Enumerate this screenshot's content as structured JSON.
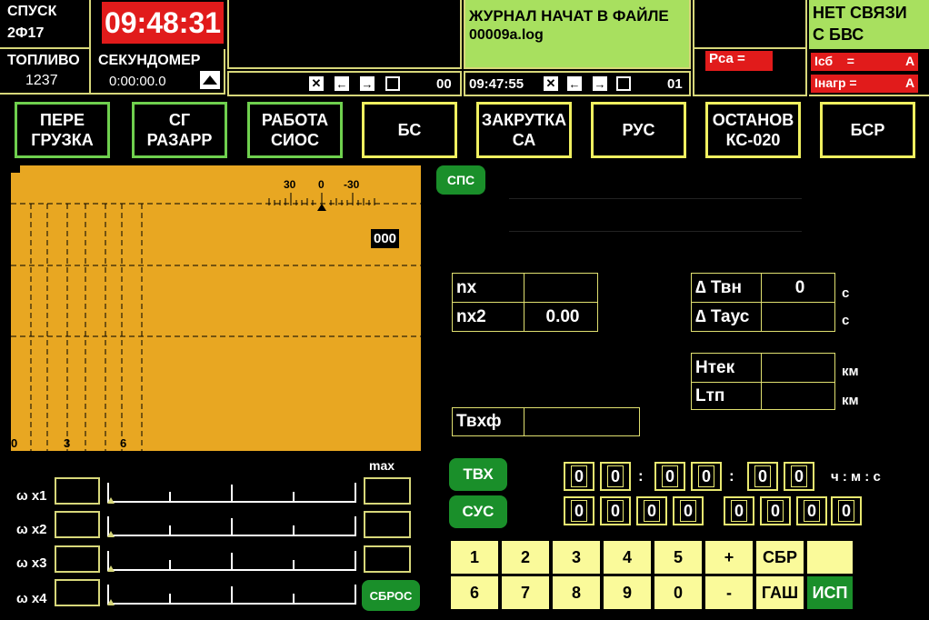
{
  "status": {
    "descent_label": "СПУСК",
    "descent_code": "2Ф17",
    "clock": "09:48:31",
    "fuel_label": "ТОПЛИВО",
    "fuel_value": "1237",
    "stopwatch_label": "СЕКУНДОМЕР",
    "stopwatch_value": "0:00:00.0"
  },
  "log": {
    "message_line1": "ЖУРНАЛ НАЧАТ В ФАЙЛЕ",
    "message_line2": "00009a.log",
    "left_counter": "00",
    "right_time": "09:47:55",
    "right_counter": "01"
  },
  "comm": {
    "rsa_label": "Рса  =",
    "status_line1": "НЕТ СВЯЗИ",
    "status_line2": "С БВС",
    "isb_label": "Iсб    =",
    "isb_unit": "А",
    "inagr_label": "Iнагр =",
    "inagr_unit": "А"
  },
  "mode_buttons": [
    {
      "line1": "ПЕРЕ",
      "line2": "ГРУЗКА"
    },
    {
      "line1": "СГ",
      "line2": "РАЗАРР"
    },
    {
      "line1": "РАБОТА",
      "line2": "СИОС"
    },
    {
      "line1": "БС",
      "line2": ""
    },
    {
      "line1": "ЗАКРУТКА",
      "line2": "СА"
    },
    {
      "line1": "РУС",
      "line2": ""
    },
    {
      "line1": "ОСТАНОВ",
      "line2": "КС-020"
    },
    {
      "line1": "БСР",
      "line2": ""
    }
  ],
  "gauge": {
    "scale_labels": [
      "30",
      "0",
      "-30"
    ],
    "readout": "000",
    "bottom_labels": [
      "0",
      "3",
      "6"
    ]
  },
  "sps_button": "СПС",
  "nx_table": {
    "nx_label": "nx",
    "nx_value": "",
    "nx2_label": "nx2",
    "nx2_value": "0.00"
  },
  "dt_table": {
    "tvn_label": "∆ Твн",
    "tvn_value": "0",
    "tvn_unit": "с",
    "taus_label": "∆ Таус",
    "taus_value": "",
    "taus_unit": "с"
  },
  "h_table": {
    "htek_label": "Нтек",
    "htek_unit": "км",
    "ltp_label": "Lтп",
    "ltp_unit": "км"
  },
  "tvxf_label": "Твхф",
  "omega": {
    "max_label": "max",
    "rows": [
      {
        "label": "ω x1"
      },
      {
        "label": "ω x2"
      },
      {
        "label": "ω x3"
      },
      {
        "label": "ω x4"
      }
    ],
    "reset_button": "СБРОС"
  },
  "tvx_button": "ТВХ",
  "sus_button": "СУС",
  "time_input": {
    "digits": [
      "0",
      "0",
      "0",
      "0",
      "0",
      "0"
    ],
    "separator": ":",
    "units": "ч : м : с"
  },
  "sus_digits": [
    "0",
    "0",
    "0",
    "0",
    "0",
    "0",
    "0",
    "0"
  ],
  "keypad": {
    "row1": [
      "1",
      "2",
      "3",
      "4",
      "5",
      "+",
      "СБР",
      ""
    ],
    "row2": [
      "6",
      "7",
      "8",
      "9",
      "0",
      "-",
      "ГАШ",
      "ИСП"
    ]
  },
  "colors": {
    "clock_bg": "#e11b1b",
    "log_bg": "#a8e05f",
    "gauge_bg": "#e8a722",
    "green_button": "#1a8f2a",
    "keypad_bg": "#fafa9a",
    "alarm_red": "#e11b1b"
  }
}
